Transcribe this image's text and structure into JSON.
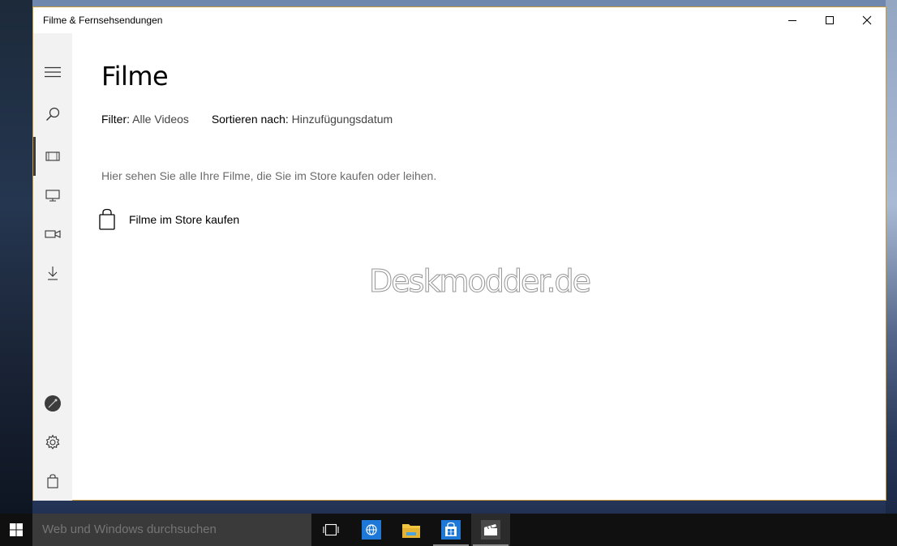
{
  "window": {
    "title": "Filme & Fernsehsendungen"
  },
  "page": {
    "title": "Filme",
    "filter_label": "Filter:",
    "filter_value": "Alle Videos",
    "sort_label": "Sortieren nach:",
    "sort_value": "Hinzufügungsdatum",
    "description": "Hier sehen Sie alle Ihre Filme, die Sie im Store kaufen oder leihen.",
    "store_link": "Filme im Store kaufen"
  },
  "sidebar": {
    "items": [
      {
        "icon": "hamburger-menu-icon"
      },
      {
        "icon": "search-icon"
      },
      {
        "icon": "film-icon",
        "selected": true
      },
      {
        "icon": "tv-icon"
      },
      {
        "icon": "video-camera-icon"
      },
      {
        "icon": "download-icon"
      },
      {
        "icon": "user-avatar-icon"
      },
      {
        "icon": "gear-icon"
      },
      {
        "icon": "store-bag-icon"
      }
    ]
  },
  "watermark": "Deskmodder.de",
  "taskbar": {
    "search_placeholder": "Web und Windows durchsuchen",
    "apps": [
      "task-view-icon",
      "edge-browser-icon",
      "file-explorer-icon",
      "store-icon",
      "movies-tv-icon"
    ]
  },
  "colors": {
    "window_border": "#c99a3a",
    "sidebar_bg": "#f2f2f2",
    "taskbar_bg": "#101010",
    "searchbox_bg": "#3a3a3a",
    "edge_blue": "#1e78d7",
    "explorer_yellow": "#f2c640"
  }
}
